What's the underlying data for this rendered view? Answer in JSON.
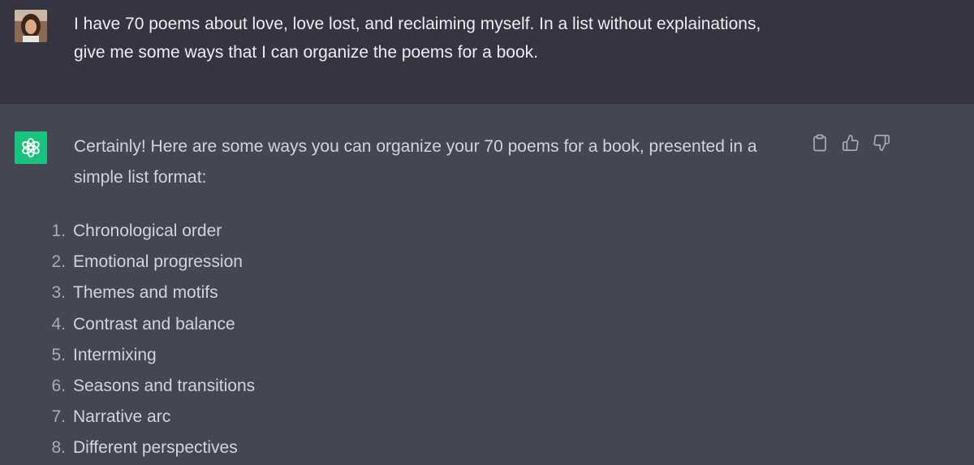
{
  "user_message": {
    "line1": "I have 70 poems about love, love lost, and reclaiming myself. In a list without explainations,",
    "line2": "give me some ways that I can organize the poems for a book."
  },
  "assistant_message": {
    "intro_line1": "Certainly! Here are some ways you can organize your 70 poems for a book, presented in a",
    "intro_line2": "simple list format:",
    "items": [
      {
        "num": "1.",
        "text": "Chronological order"
      },
      {
        "num": "2.",
        "text": "Emotional progression"
      },
      {
        "num": "3.",
        "text": "Themes and motifs"
      },
      {
        "num": "4.",
        "text": "Contrast and balance"
      },
      {
        "num": "5.",
        "text": "Intermixing"
      },
      {
        "num": "6.",
        "text": "Seasons and transitions"
      },
      {
        "num": "7.",
        "text": "Narrative arc"
      },
      {
        "num": "8.",
        "text": "Different perspectives"
      }
    ]
  },
  "actions": {
    "copy": "clipboard-icon",
    "like": "thumbs-up-icon",
    "dislike": "thumbs-down-icon"
  },
  "colors": {
    "user_bg": "#343541",
    "assistant_bg": "#444654",
    "bot_avatar": "#19c37d"
  }
}
